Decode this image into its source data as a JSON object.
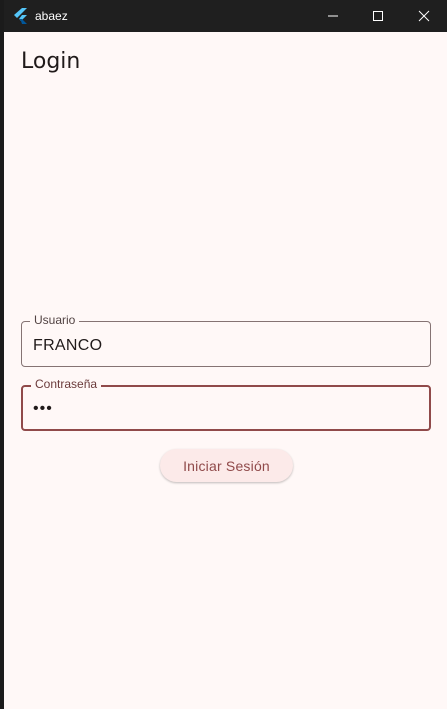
{
  "window": {
    "title": "abaez",
    "controls": [
      "minimize",
      "maximize",
      "close"
    ]
  },
  "page": {
    "title": "Login"
  },
  "form": {
    "username": {
      "label": "Usuario",
      "value": "FRANCO"
    },
    "password": {
      "label": "Contraseña",
      "value": "•••"
    },
    "submit_label": "Iniciar Sesión"
  },
  "colors": {
    "background": "#fff8f7",
    "titlebar": "#1f1f1f",
    "accent": "#904a4a",
    "button_background": "#fceae9"
  },
  "icons": {
    "app": "flutter-logo-icon",
    "minimize": "minimize-icon",
    "maximize": "maximize-icon",
    "close": "close-icon"
  }
}
